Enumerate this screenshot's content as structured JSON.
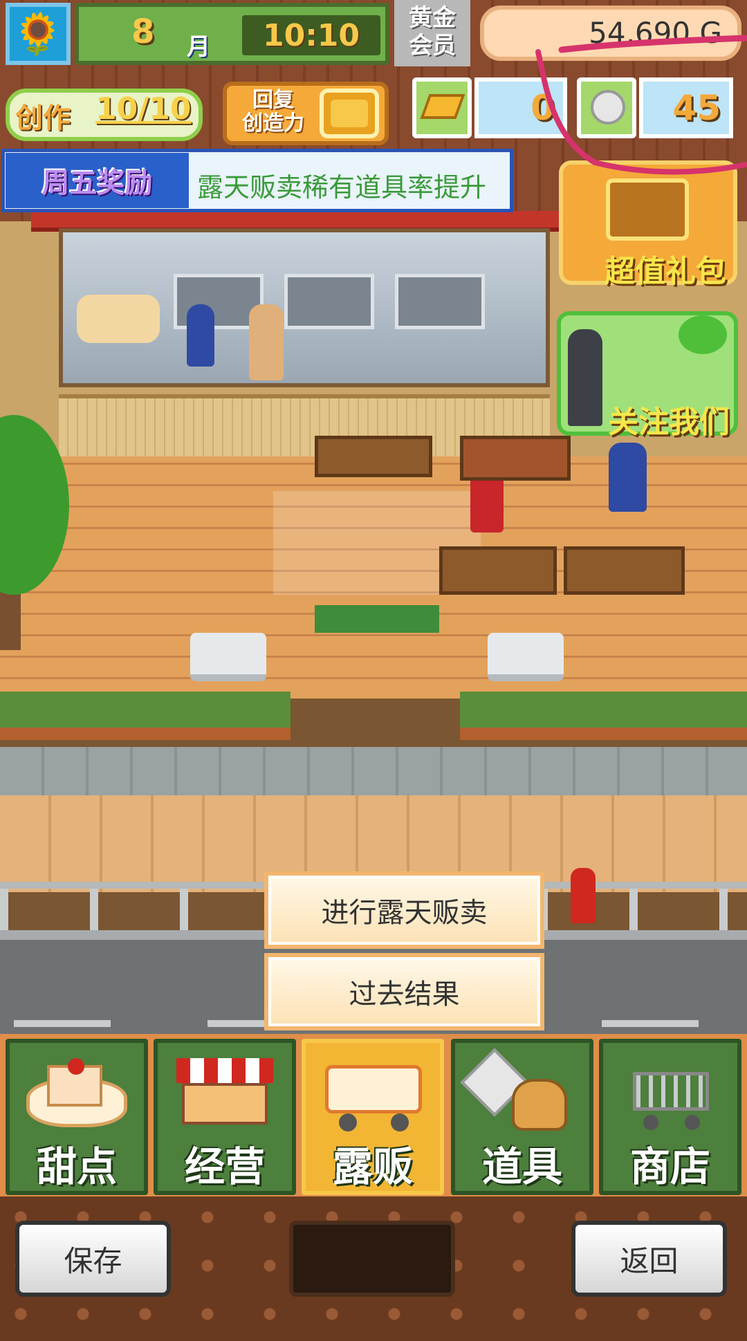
{
  "hud": {
    "avatar_icon": "sunflower-icon",
    "month_num": "8",
    "month_label": "月",
    "time": "10:10",
    "vip_label_line1": "黄金",
    "vip_label_line2": "会员",
    "money": "54,690 G",
    "create_label": "创作",
    "create_value": "10/10",
    "restore_label_line1": "回复",
    "restore_label_line2": "创造力",
    "gold_bar_count": "0",
    "coin_count": "45"
  },
  "banner": {
    "tag": "周五奖励",
    "text": "露天贩卖稀有道具率提升"
  },
  "promos": {
    "gift_pack": "超值礼包",
    "follow_us": "关注我们"
  },
  "popup": {
    "start_stall": "进行露天贩卖",
    "past_results": "过去结果"
  },
  "nav": {
    "items": [
      {
        "label": "甜点",
        "icon": "cake-icon"
      },
      {
        "label": "经营",
        "icon": "shop-icon"
      },
      {
        "label": "露贩",
        "icon": "food-truck-icon"
      },
      {
        "label": "道具",
        "icon": "items-bag-icon"
      },
      {
        "label": "商店",
        "icon": "cart-icon"
      }
    ],
    "active_index": 2
  },
  "footer": {
    "save": "保存",
    "back": "返回"
  },
  "colors": {
    "nav_green": "#4d7f3d",
    "nav_active": "#f3b534",
    "annotation_stroke": "#d6336c"
  }
}
